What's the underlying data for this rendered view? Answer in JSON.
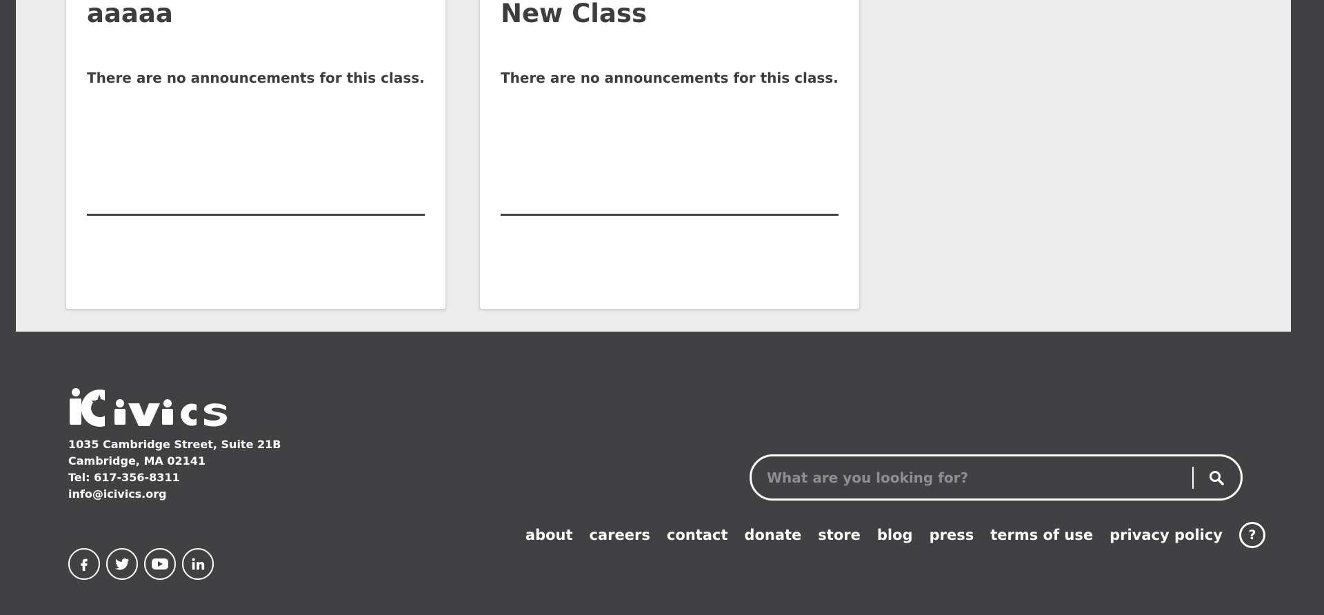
{
  "classes": [
    {
      "title": "aaaaa",
      "message": "There are no announcements for this class."
    },
    {
      "title": "New Class",
      "message": "There are no announcements for this class."
    }
  ],
  "footer": {
    "logo_text": "iCivics",
    "address_lines": [
      "1035 Cambridge Street, Suite 21B",
      "Cambridge, MA 02141",
      "Tel: 617-356-8311",
      "info@icivics.org"
    ],
    "search": {
      "placeholder": "What are you looking for?",
      "icon": "search-icon"
    },
    "nav": [
      "about",
      "careers",
      "contact",
      "donate",
      "store",
      "blog",
      "press",
      "terms of use",
      "privacy policy"
    ],
    "help_label": "?",
    "social": [
      "facebook-icon",
      "twitter-icon",
      "youtube-icon",
      "linkedin-icon"
    ]
  },
  "colors": {
    "footer_bg": "#414143",
    "content_bg": "#ececec",
    "card_bg": "#ffffff",
    "text_dark": "#3d3d3f"
  }
}
